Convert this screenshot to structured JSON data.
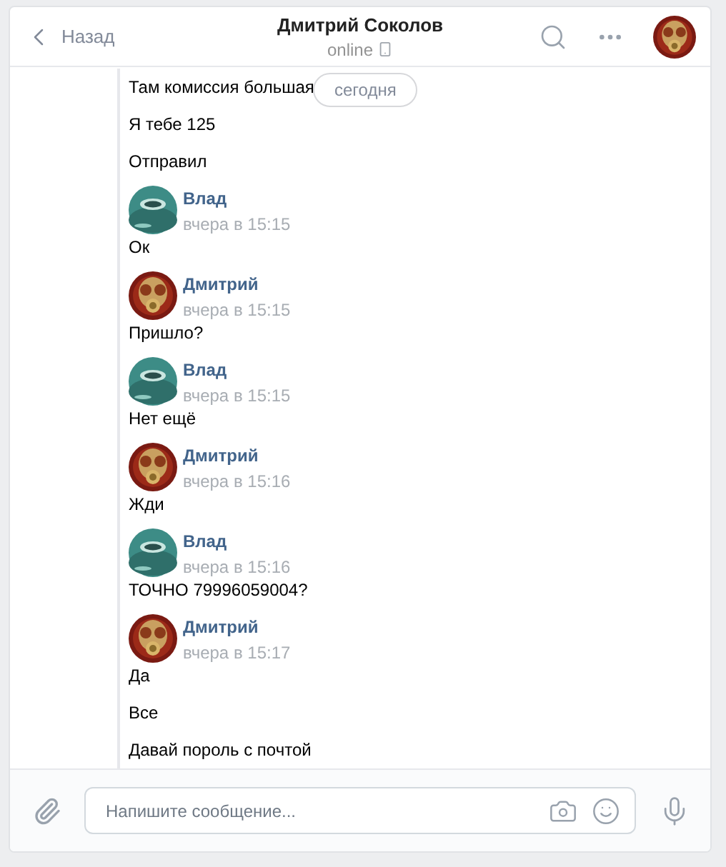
{
  "header": {
    "back": "Назад",
    "title": "Дмитрий Соколов",
    "status": "online"
  },
  "date_badge": "сегодня",
  "groups": [
    {
      "messages": [
        "Там комиссия большая",
        "Я тебе 125",
        "Отправил"
      ]
    },
    {
      "kind": "own",
      "author": "Влад",
      "time": "вчера в 15:15",
      "messages": [
        "Ок"
      ]
    },
    {
      "kind": "peer",
      "author": "Дмитрий",
      "time": "вчера в 15:15",
      "messages": [
        "Пришло?"
      ]
    },
    {
      "kind": "own",
      "author": "Влад",
      "time": "вчера в 15:15",
      "messages": [
        "Нет ещё"
      ]
    },
    {
      "kind": "peer",
      "author": "Дмитрий",
      "time": "вчера в 15:16",
      "messages": [
        "Жди"
      ]
    },
    {
      "kind": "own",
      "author": "Влад",
      "time": "вчера в 15:16",
      "messages": [
        "ТОЧНО 79996059004?"
      ]
    },
    {
      "kind": "peer",
      "author": "Дмитрий",
      "time": "вчера в 15:17",
      "messages": [
        "Да",
        "Все",
        "Давай пороль с почтой"
      ]
    }
  ],
  "composer": {
    "placeholder": "Напишите сообщение..."
  }
}
